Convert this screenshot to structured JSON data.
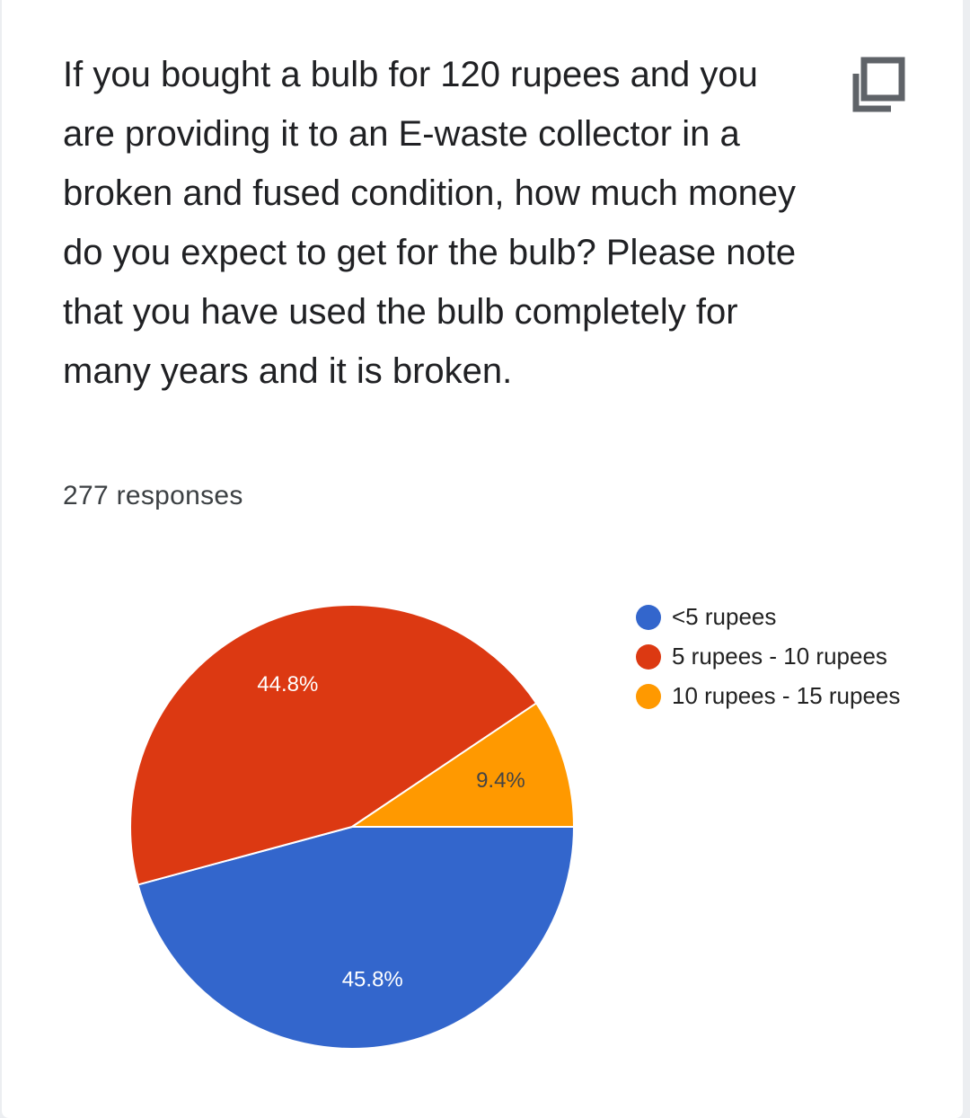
{
  "question": {
    "text": "If you bought a bulb for 120 rupees and you are providing it to an E-waste collector in a broken and fused condition, how much money do you expect to get for the bulb? Please note that you have used the bulb completely for many years and it is broken.",
    "responses_label": "277 responses",
    "copy_icon": "copy-chart-icon"
  },
  "chart_data": {
    "type": "pie",
    "title": "",
    "slices": [
      {
        "label": "<5 rupees",
        "value": 45.8,
        "value_label": "45.8%",
        "color": "#3366cc"
      },
      {
        "label": "5 rupees - 10 rupees",
        "value": 44.8,
        "value_label": "44.8%",
        "color": "#dc3912"
      },
      {
        "label": "10 rupees - 15 rupees",
        "value": 9.4,
        "value_label": "9.4%",
        "color": "#ff9900"
      }
    ],
    "legend_position": "right"
  }
}
